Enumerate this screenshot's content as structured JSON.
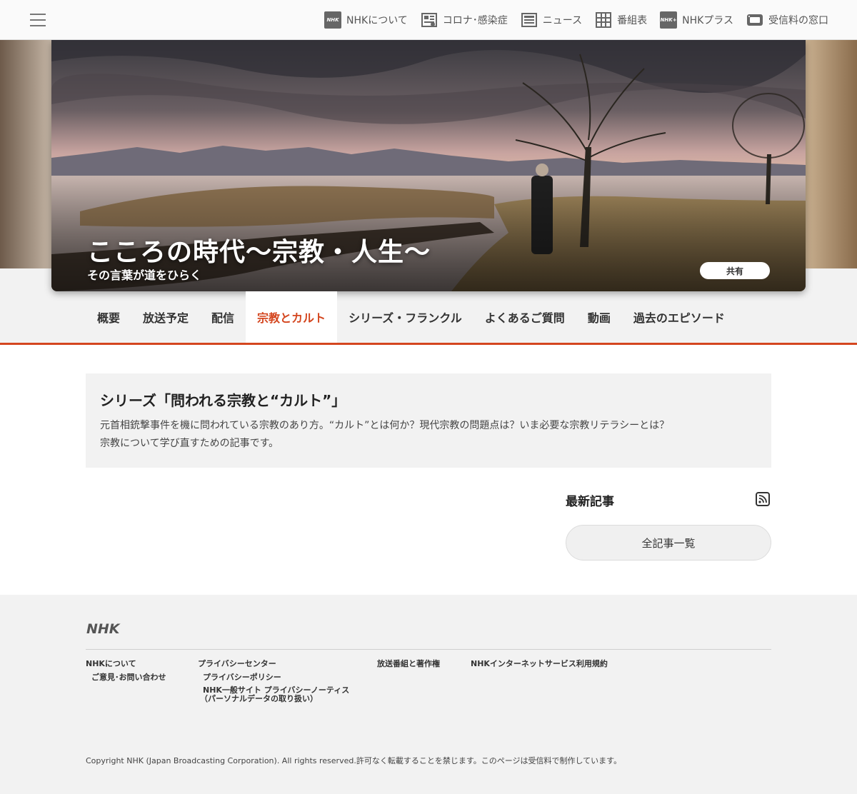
{
  "topnav": {
    "items": [
      {
        "label": "NHKについて",
        "icon": "nhk-logo-icon"
      },
      {
        "label": "コロナ･感染症",
        "icon": "virus-news-icon"
      },
      {
        "label": "ニュース",
        "icon": "newspaper-icon"
      },
      {
        "label": "番組表",
        "icon": "grid-schedule-icon"
      },
      {
        "label": "NHKプラス",
        "icon": "nhk-plus-icon"
      },
      {
        "label": "受信料の窓口",
        "icon": "tv-reception-icon"
      }
    ]
  },
  "hero": {
    "title": "こころの時代～宗教・人生～",
    "subtitle": "その言葉が道をひらく",
    "share_label": "共有"
  },
  "tabs": [
    {
      "label": "概要",
      "active": false
    },
    {
      "label": "放送予定",
      "active": false
    },
    {
      "label": "配信",
      "active": false
    },
    {
      "label": "宗教とカルト",
      "active": true
    },
    {
      "label": "シリーズ・フランクル",
      "active": false
    },
    {
      "label": "よくあるご質問",
      "active": false
    },
    {
      "label": "動画",
      "active": false
    },
    {
      "label": "過去のエピソード",
      "active": false
    }
  ],
  "series": {
    "title": "シリーズ「問われる宗教と“カルト”」",
    "desc_line1": "元首相銃撃事件を機に問われている宗教のあり方。“カルト”とは何か？現代宗教の問題点は？いま必要な宗教リテラシーとは？",
    "desc_line2": "宗教について学び直すための記事です。"
  },
  "latest": {
    "title": "最新記事",
    "all_button": "全記事一覧"
  },
  "footer": {
    "logo": "NHK",
    "links": {
      "about": "NHKについて",
      "opinion": "ご意見･お問い合わせ",
      "privacy_center": "プライバシーセンター",
      "privacy_policy": "プライバシーポリシー",
      "privacy_notice_1": "NHK一般サイト プライバシーノーティス",
      "privacy_notice_2": "（パーソナルデータの取り扱い）",
      "copyright_programs": "放送番組と著作権",
      "terms": "NHKインターネットサービス利用規約"
    },
    "copyright": "Copyright NHK (Japan Broadcasting Corporation). All rights reserved.許可なく転載することを禁じます。このページは受信料で制作しています。"
  },
  "colors": {
    "accent": "#d4461f",
    "footer_bg": "#f2f2f2"
  }
}
